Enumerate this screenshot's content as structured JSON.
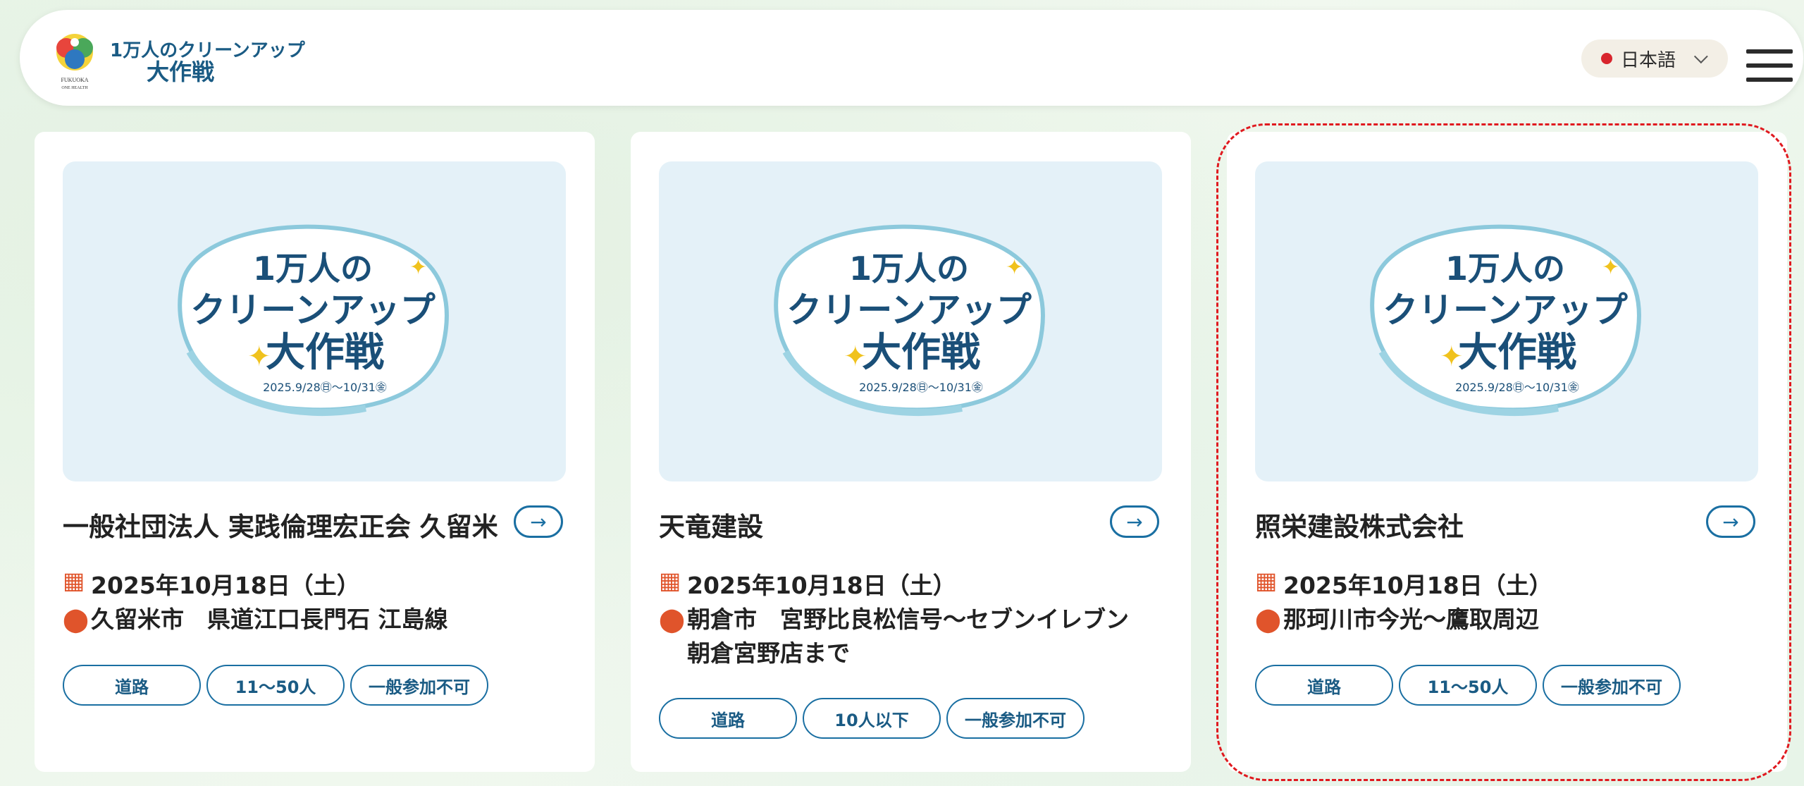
{
  "header": {
    "logo_line1": "1万人のクリーンアップ",
    "logo_line2": "大作戦",
    "logo_sub1": "FUKUOKA",
    "logo_sub2": "ONE HEALTH",
    "language_label": "日本語",
    "language_dot_color": "#d8252d",
    "menu_icon": "hamburger-menu-icon"
  },
  "thumbnail": {
    "line1": "1万人の",
    "line2": "クリーンアップ",
    "line3": "大作戦",
    "dates": "2025.9/28㊐〜10/31㊎"
  },
  "cards": [
    {
      "title": "一般社団法人 実践倫理宏正会 久留米",
      "date": "2025年10月18日（土）",
      "place": "久留米市　県道江口長門石 江島線",
      "tags": [
        "道路",
        "11〜50人",
        "一般参加不可"
      ]
    },
    {
      "title": "天竜建設",
      "date": "2025年10月18日（土）",
      "place": "朝倉市　宮野比良松信号〜セブンイレブン朝倉宮野店まで",
      "tags": [
        "道路",
        "10人以下",
        "一般参加不可"
      ]
    },
    {
      "title": "照栄建設株式会社",
      "date": "2025年10月18日（土）",
      "place": "那珂川市今光〜鷹取周辺",
      "tags": [
        "道路",
        "11〜50人",
        "一般参加不可"
      ]
    }
  ],
  "colors": {
    "accent": "#1a6fa2",
    "icon_orange": "#e0542b",
    "highlight": "#e0191f"
  }
}
